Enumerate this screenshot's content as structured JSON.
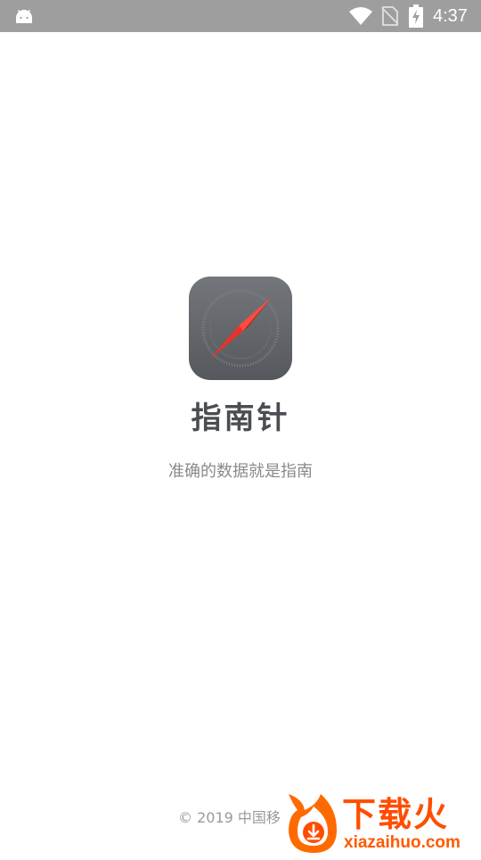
{
  "status_bar": {
    "time": "4:37",
    "icons": [
      "android-icon",
      "wifi-icon",
      "no-sim-icon",
      "battery-charging-icon"
    ]
  },
  "splash": {
    "app_icon": "compass-icon",
    "app_name": "指南针",
    "slogan": "准确的数据就是指南"
  },
  "footer": {
    "copyright": "© 2019 中国移"
  },
  "watermark": {
    "logo": "flame-download-logo",
    "title": "下载火",
    "url": "xiazaihuo.com"
  },
  "colors": {
    "status_bar_bg": "#9e9e9e",
    "icon_bg": "#63676b",
    "needle_red": "#e8322c",
    "app_name": "#4a4d52",
    "slogan": "#8a8a8a",
    "watermark": "#ff4d00"
  }
}
